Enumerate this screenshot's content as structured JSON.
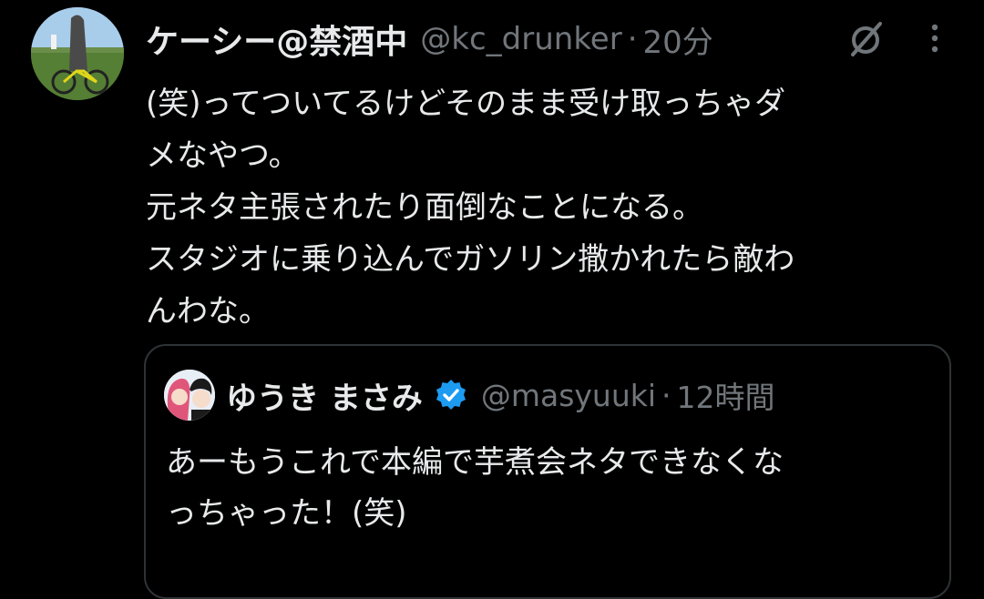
{
  "tweet": {
    "author": {
      "display_name": "ケーシー@禁酒中",
      "handle": "@kc_drunker",
      "separator": "·",
      "time": "20分"
    },
    "body_lines": [
      "(笑)ってついてるけどそのまま受け取っちゃダ",
      "メなやつ。",
      "元ネタ主張されたり面倒なことになる。",
      "スタジオに乗り込んでガソリン撒かれたら敵わ",
      "んわな。"
    ],
    "icons": {
      "grok": "grok-slash-icon",
      "more": "more-vertical-icon"
    },
    "quoted": {
      "display_name": "ゆうき まさみ",
      "verified": true,
      "handle": "@masyuuki",
      "separator": "·",
      "time": "12時間",
      "body_lines": [
        "あーもうこれで本編で芋煮会ネタできなくな",
        "っちゃった！(笑)"
      ]
    }
  },
  "colors": {
    "background": "#000000",
    "text_primary": "#e7e9ea",
    "text_secondary": "#71767b",
    "border": "#2f3336",
    "verified": "#1d9bf0"
  }
}
